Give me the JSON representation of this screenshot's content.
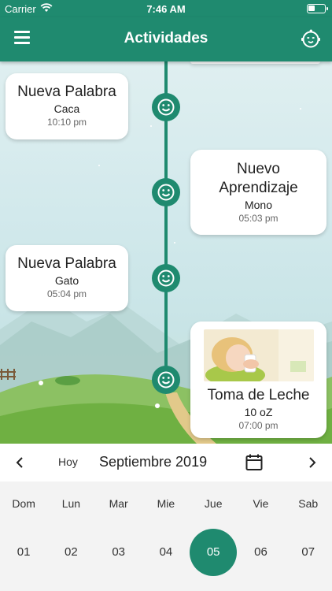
{
  "status_bar": {
    "carrier": "Carrier",
    "time": "7:46 AM"
  },
  "header": {
    "title": "Actividades"
  },
  "activities": [
    {
      "title": "Nueva Palabra",
      "detail": "Caca",
      "time": "10:10 pm"
    },
    {
      "title": "Nuevo Aprendizaje",
      "detail": "Mono",
      "time": "05:03 pm"
    },
    {
      "title": "Nueva Palabra",
      "detail": "Gato",
      "time": "05:04 pm"
    },
    {
      "title": "Toma de Leche",
      "detail": "10 oZ",
      "time": "07:00 pm"
    }
  ],
  "date_nav": {
    "today_label": "Hoy",
    "month_label": "Septiembre 2019"
  },
  "week": {
    "day_names": [
      "Dom",
      "Lun",
      "Mar",
      "Mie",
      "Jue",
      "Vie",
      "Sab"
    ],
    "dates": [
      "01",
      "02",
      "03",
      "04",
      "05",
      "06",
      "07"
    ],
    "selected_index": 4
  },
  "colors": {
    "primary": "#1f8a6f",
    "card": "#ffffff",
    "calendar_bg": "#f3f3f3"
  },
  "icons": {
    "menu": "menu-icon",
    "header_right": "baby-face-icon",
    "timeline_node": "smiley-face-icon",
    "calendar": "calendar-icon"
  }
}
